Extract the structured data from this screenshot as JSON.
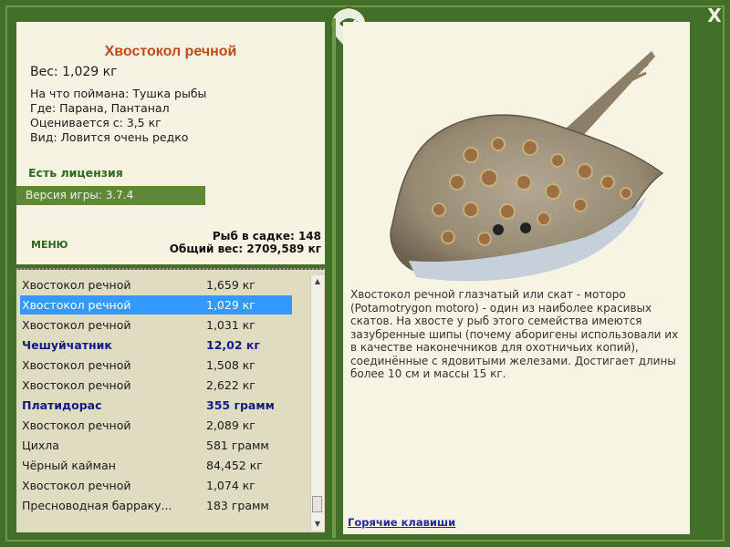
{
  "fish": {
    "title": "Хвостокол речной",
    "weight": "Вес: 1,029 кг",
    "caught_on": "На что поймана: Тушка рыбы",
    "where": "Где: Парана, Пантанал",
    "valued_from": "Оценивается с: 3,5 кг",
    "kind": "Вид: Ловится очень редко"
  },
  "license": "Есть лицензия",
  "version": "Версия игры: 3.7.4",
  "menu_label": "МЕНЮ",
  "stats": {
    "fish_in_keepnet": "Рыб в садке: 148",
    "total_weight": "Общий вес: 2709,589 кг"
  },
  "catch_list": [
    {
      "name": "Хвостокол речной",
      "value": "1,659 кг"
    },
    {
      "name": "Хвостокол речной",
      "value": "1,029 кг"
    },
    {
      "name": "Хвостокол речной",
      "value": "1,031 кг"
    },
    {
      "name": "Чешуйчатник",
      "value": "12,02 кг"
    },
    {
      "name": "Хвостокол речной",
      "value": "1,508 кг"
    },
    {
      "name": "Хвостокол речной",
      "value": "2,622 кг"
    },
    {
      "name": "Платидорас",
      "value": "355 грамм"
    },
    {
      "name": "Хвостокол речной",
      "value": "2,089 кг"
    },
    {
      "name": "Цихла",
      "value": "581 грамм"
    },
    {
      "name": "Чёрный кайман",
      "value": "84,452 кг"
    },
    {
      "name": "Хвостокол речной",
      "value": "1,074 кг"
    },
    {
      "name": "Пресноводная барраку...",
      "value": "183 грамм"
    }
  ],
  "description": "Хвостокол речной глазчатый или скат - моторо (Potamotrygon motoro) - один из наиболее красивых скатов. На хвосте у рыб этого семейства имеются зазубренные шипы (почему аборигены использовали их в качестве наконечников для охотничьих копий), соединённые с ядовитыми железами. Достигает длины более 10 см и массы 15 кг.",
  "hotkeys": "Горячие клавиши",
  "close_label": "X",
  "colors": {
    "frame": "#42702a",
    "panel": "#f6f3e3",
    "list_bg": "#e0dcc2",
    "title": "#c0491a",
    "selected": "#3399ff",
    "highlight_text": "#111a86"
  },
  "icons": {
    "close": "close-icon",
    "logo": "fish-logo-icon",
    "fish": "stingray-image"
  }
}
